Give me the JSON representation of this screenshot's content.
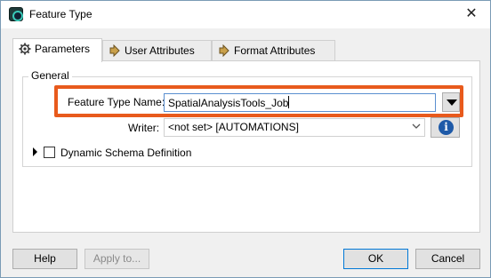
{
  "window": {
    "title": "Feature Type",
    "close_glyph": "✕"
  },
  "tabs": [
    {
      "label": "Parameters",
      "icon": "gear-icon",
      "active": true
    },
    {
      "label": "User Attributes",
      "icon": "arrow-right-icon",
      "active": false
    },
    {
      "label": "Format Attributes",
      "icon": "arrow-right-icon",
      "active": false
    }
  ],
  "general": {
    "group_label": "General",
    "feature_type_name_label": "Feature Type Name:",
    "feature_type_name_value": "SpatialAnalysisTools_Job",
    "writer_label": "Writer:",
    "writer_value": "<not set> [AUTOMATIONS]",
    "info_glyph": "i",
    "dynamic_schema_label": "Dynamic Schema Definition",
    "dynamic_schema_checked": false
  },
  "buttons": {
    "help": "Help",
    "apply": "Apply to...",
    "ok": "OK",
    "cancel": "Cancel"
  },
  "colors": {
    "highlight": "#e85a1c",
    "info_blue": "#1e5aa8"
  }
}
